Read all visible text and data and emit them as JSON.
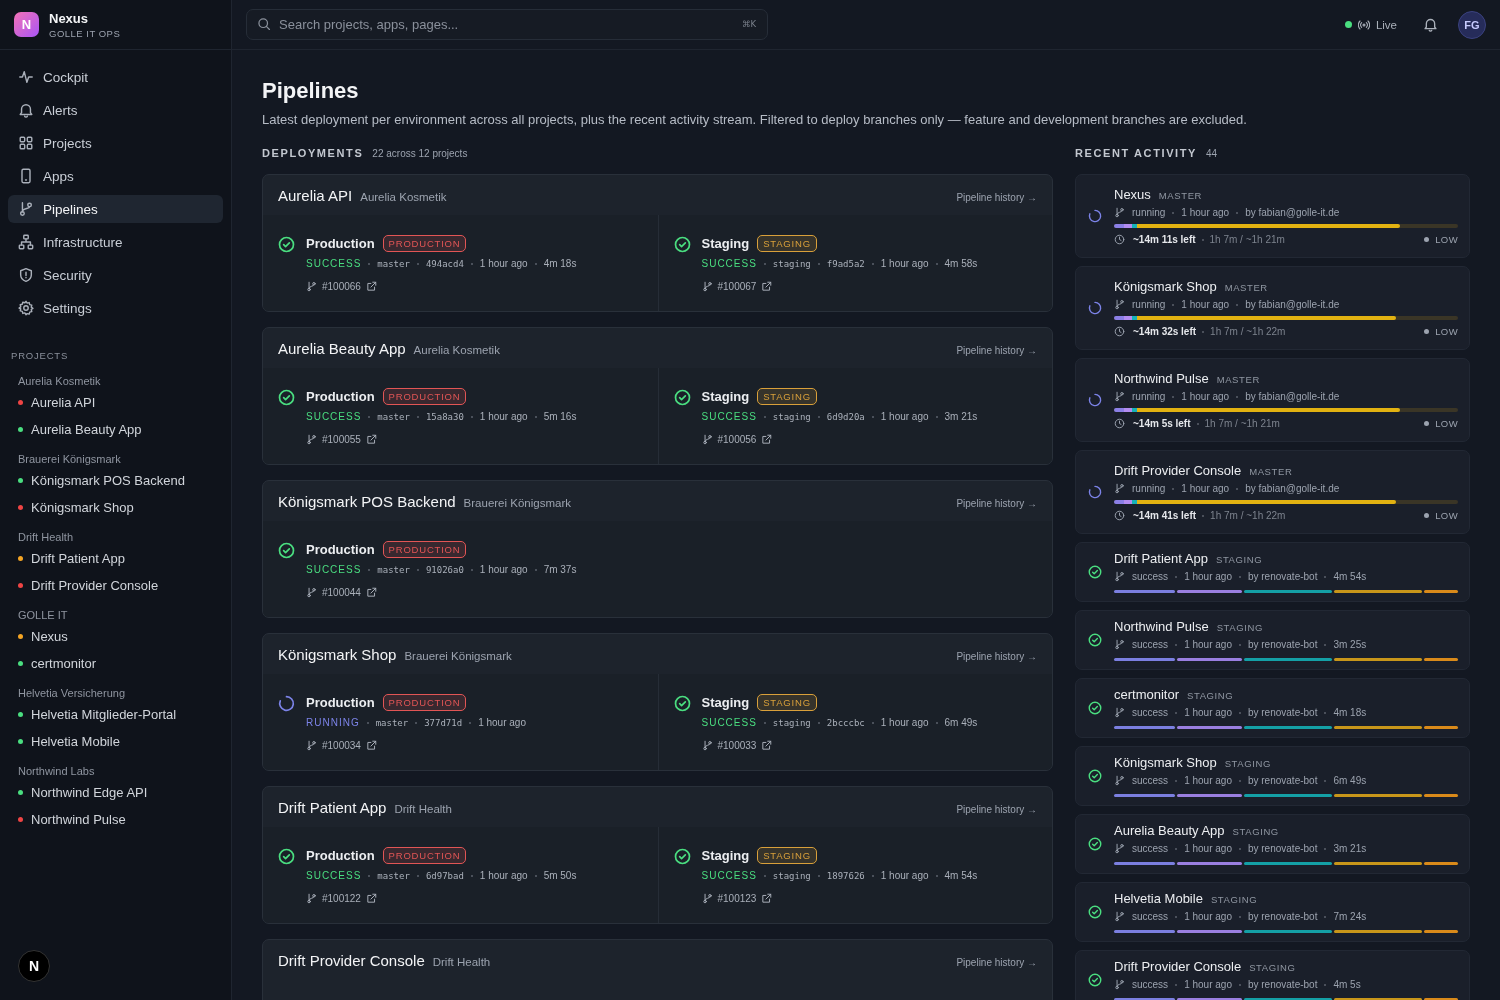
{
  "sidebar": {
    "logo": "N",
    "brand": "Nexus",
    "subtitle": "GOLLE IT OPS",
    "nav": [
      {
        "label": "Cockpit",
        "selected": false
      },
      {
        "label": "Alerts",
        "selected": false
      },
      {
        "label": "Projects",
        "selected": false
      },
      {
        "label": "Apps",
        "selected": false
      },
      {
        "label": "Pipelines",
        "selected": true
      },
      {
        "label": "Infrastructure",
        "selected": false
      },
      {
        "label": "Security",
        "selected": false
      },
      {
        "label": "Settings",
        "selected": false
      }
    ],
    "projects_heading": "PROJECTS",
    "groups": [
      {
        "name": "Aurelia Kosmetik",
        "projects": [
          {
            "name": "Aurelia API",
            "color": "#ef4444"
          },
          {
            "name": "Aurelia Beauty App",
            "color": "#4ade80"
          }
        ]
      },
      {
        "name": "Brauerei Königsmark",
        "projects": [
          {
            "name": "Königsmark POS Backend",
            "color": "#4ade80"
          },
          {
            "name": "Königsmark Shop",
            "color": "#ef4444"
          }
        ]
      },
      {
        "name": "Drift Health",
        "projects": [
          {
            "name": "Drift Patient App",
            "color": "#f5a524"
          },
          {
            "name": "Drift Provider Console",
            "color": "#ef4444"
          }
        ]
      },
      {
        "name": "GOLLE IT",
        "projects": [
          {
            "name": "Nexus",
            "color": "#f5a524"
          },
          {
            "name": "certmonitor",
            "color": "#4ade80"
          }
        ]
      },
      {
        "name": "Helvetia Versicherung",
        "projects": [
          {
            "name": "Helvetia Mitglieder-Portal",
            "color": "#4ade80"
          },
          {
            "name": "Helvetia Mobile",
            "color": "#4ade80"
          }
        ]
      },
      {
        "name": "Northwind Labs",
        "projects": [
          {
            "name": "Northwind Edge API",
            "color": "#4ade80"
          },
          {
            "name": "Northwind Pulse",
            "color": "#ef4444"
          }
        ]
      }
    ],
    "dev_badge": "N"
  },
  "topbar": {
    "search": {
      "placeholder": "Search projects, apps, pages...",
      "shortcut": "⌘K"
    },
    "live": "Live",
    "avatar": "FG"
  },
  "page": {
    "title": "Pipelines",
    "description": "Latest deployment per environment across all projects, plus the recent activity stream. Filtered to deploy branches only — feature and development branches are excluded."
  },
  "deployments": {
    "heading": "DEPLOYMENTS",
    "count": "22 across 12 projects",
    "cards": [
      {
        "app": "Aurelia API",
        "org": "Aurelia Kosmetik",
        "history": "Pipeline history →",
        "envs": [
          {
            "color": "#e25555",
            "kind": "passed",
            "title": "Production",
            "badge": "PRODUCTION",
            "status": "SUCCESS",
            "branch": "master",
            "commit": "494acd4",
            "time": "1 hour ago",
            "duration": "4m 18s",
            "pipeline": "#100066"
          },
          {
            "color": "#d9a03a",
            "kind": "passed",
            "title": "Staging",
            "badge": "STAGING",
            "status": "SUCCESS",
            "branch": "staging",
            "commit": "f9ad5a2",
            "time": "1 hour ago",
            "duration": "4m 58s",
            "pipeline": "#100067"
          }
        ]
      },
      {
        "app": "Aurelia Beauty App",
        "org": "Aurelia Kosmetik",
        "history": "Pipeline history →",
        "envs": [
          {
            "color": "#e25555",
            "kind": "passed",
            "title": "Production",
            "badge": "PRODUCTION",
            "status": "SUCCESS",
            "branch": "master",
            "commit": "15a8a30",
            "time": "1 hour ago",
            "duration": "5m 16s",
            "pipeline": "#100055"
          },
          {
            "color": "#d9a03a",
            "kind": "passed",
            "title": "Staging",
            "badge": "STAGING",
            "status": "SUCCESS",
            "branch": "staging",
            "commit": "6d9d20a",
            "time": "1 hour ago",
            "duration": "3m 21s",
            "pipeline": "#100056"
          }
        ]
      },
      {
        "app": "Königsmark POS Backend",
        "org": "Brauerei Königsmark",
        "history": "Pipeline history →",
        "envs": [
          {
            "color": "#e25555",
            "kind": "passed",
            "title": "Production",
            "badge": "PRODUCTION",
            "status": "SUCCESS",
            "branch": "master",
            "commit": "91026a0",
            "time": "1 hour ago",
            "duration": "7m 37s",
            "pipeline": "#100044"
          }
        ]
      },
      {
        "app": "Königsmark Shop",
        "org": "Brauerei Königsmark",
        "history": "Pipeline history →",
        "envs": [
          {
            "color": "#e25555",
            "kind": "in_progress",
            "title": "Production",
            "badge": "PRODUCTION",
            "status": "RUNNING",
            "branch": "master",
            "commit": "377d71d",
            "time": "1 hour ago",
            "pipeline": "#100034"
          },
          {
            "color": "#d9a03a",
            "kind": "passed",
            "title": "Staging",
            "badge": "STAGING",
            "status": "SUCCESS",
            "branch": "staging",
            "commit": "2bcccbc",
            "time": "1 hour ago",
            "duration": "6m 49s",
            "pipeline": "#100033"
          }
        ]
      },
      {
        "app": "Drift Patient App",
        "org": "Drift Health",
        "history": "Pipeline history →",
        "envs": [
          {
            "color": "#e25555",
            "kind": "passed",
            "title": "Production",
            "badge": "PRODUCTION",
            "status": "SUCCESS",
            "branch": "master",
            "commit": "6d97bad",
            "time": "1 hour ago",
            "duration": "5m 50s",
            "pipeline": "#100122"
          },
          {
            "color": "#d9a03a",
            "kind": "passed",
            "title": "Staging",
            "badge": "STAGING",
            "status": "SUCCESS",
            "branch": "staging",
            "commit": "1897626",
            "time": "1 hour ago",
            "duration": "4m 54s",
            "pipeline": "#100123"
          }
        ]
      },
      {
        "app": "Drift Provider Console",
        "org": "Drift Health",
        "history": "Pipeline history →"
      }
    ]
  },
  "activity": {
    "heading": "RECENT ACTIVITY",
    "count": "44",
    "items": [
      {
        "kind": "in_progress",
        "name": "Nexus",
        "branch": "MASTER",
        "status": "running",
        "time": "1 hour ago",
        "author": "by fabian@golle-it.de",
        "level": 0.83,
        "remaining": "~14m 11s left",
        "elapsed": "1h 7m / ~1h 21m",
        "priority": "LOW"
      },
      {
        "kind": "in_progress",
        "name": "Königsmark Shop",
        "branch": "MASTER",
        "status": "running",
        "time": "1 hour ago",
        "author": "by fabian@golle-it.de",
        "level": 0.82,
        "remaining": "~14m 32s left",
        "elapsed": "1h 7m / ~1h 22m",
        "priority": "LOW"
      },
      {
        "kind": "in_progress",
        "name": "Northwind Pulse",
        "branch": "MASTER",
        "status": "running",
        "time": "1 hour ago",
        "author": "by fabian@golle-it.de",
        "level": 0.83,
        "remaining": "~14m 5s left",
        "elapsed": "1h 7m / ~1h 21m",
        "priority": "LOW"
      },
      {
        "kind": "in_progress",
        "name": "Drift Provider Console",
        "branch": "MASTER",
        "status": "running",
        "time": "1 hour ago",
        "author": "by fabian@golle-it.de",
        "level": 0.82,
        "remaining": "~14m 41s left",
        "elapsed": "1h 7m / ~1h 22m",
        "priority": "LOW"
      },
      {
        "kind": "passed",
        "name": "Drift Patient App",
        "branch": "STAGING",
        "status": "success",
        "time": "1 hour ago",
        "author": "by renovate-bot",
        "duration": "4m 54s"
      },
      {
        "kind": "passed",
        "name": "Northwind Pulse",
        "branch": "STAGING",
        "status": "success",
        "time": "1 hour ago",
        "author": "by renovate-bot",
        "duration": "3m 25s"
      },
      {
        "kind": "passed",
        "name": "certmonitor",
        "branch": "STAGING",
        "status": "success",
        "time": "1 hour ago",
        "author": "by renovate-bot",
        "duration": "4m 18s"
      },
      {
        "kind": "passed",
        "name": "Königsmark Shop",
        "branch": "STAGING",
        "status": "success",
        "time": "1 hour ago",
        "author": "by renovate-bot",
        "duration": "6m 49s"
      },
      {
        "kind": "passed",
        "name": "Aurelia Beauty App",
        "branch": "STAGING",
        "status": "success",
        "time": "1 hour ago",
        "author": "by renovate-bot",
        "duration": "3m 21s"
      },
      {
        "kind": "passed",
        "name": "Helvetia Mobile",
        "branch": "STAGING",
        "status": "success",
        "time": "1 hour ago",
        "author": "by renovate-bot",
        "duration": "7m 24s"
      },
      {
        "kind": "passed",
        "name": "Drift Provider Console",
        "branch": "STAGING",
        "status": "success",
        "time": "1 hour ago",
        "author": "by renovate-bot",
        "duration": "4m 5s"
      }
    ]
  }
}
